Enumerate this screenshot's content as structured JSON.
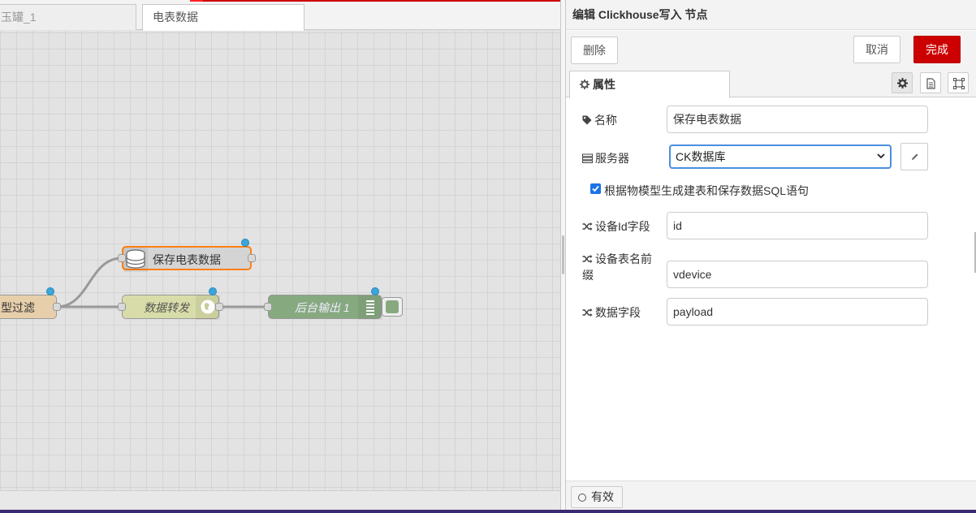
{
  "workspace": {
    "tabs": [
      {
        "label": "玉罐_1"
      },
      {
        "label": "电表数据"
      }
    ],
    "nodes": {
      "filter_label": "型过滤",
      "save_label": "保存电表数据",
      "forward_label": "数据转发",
      "debug_label": "后台输出 1"
    },
    "colors": {
      "filter_node": "#e8cfab",
      "save_node": "#d4d4d4",
      "forward_node": "#d8dca8",
      "debug_node": "#87a980",
      "status_dot": "#3aa6d9",
      "selected_outline": "#ff7f0e"
    }
  },
  "editor": {
    "title": "编辑 Clickhouse写入 节点",
    "delete_label": "删除",
    "cancel_label": "取消",
    "done_label": "完成",
    "properties_tab": "属性",
    "fields": {
      "name": {
        "label": "名称",
        "value": "保存电表数据"
      },
      "server": {
        "label": "服务器",
        "value": "CK数据库"
      },
      "auto_sql": {
        "label": "根据物模型生成建表和保存数据SQL语句",
        "checked": true
      },
      "device_id": {
        "label": "设备Id字段",
        "value": "id"
      },
      "table_prefix": {
        "label_line1": "设备表名前",
        "label_line2": "缀",
        "value": "vdevice"
      },
      "data_field": {
        "label": "数据字段",
        "value": "payload"
      }
    },
    "enabled_label": "有效",
    "colors": {
      "primary": "#cc0000",
      "select_focus": "#4a8fe0"
    }
  }
}
